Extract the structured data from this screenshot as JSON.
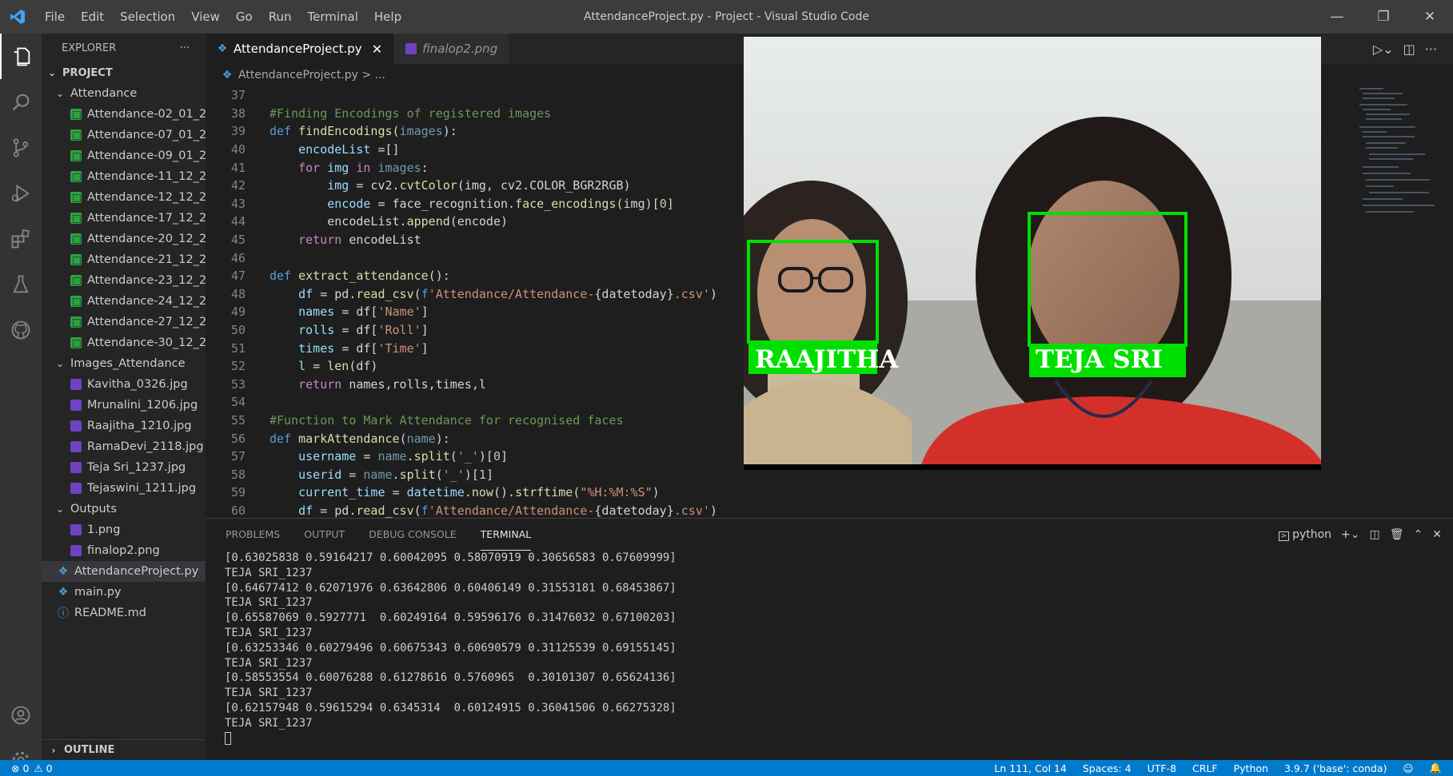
{
  "window": {
    "title": "AttendanceProject.py - Project - Visual Studio Code",
    "menu": [
      "File",
      "Edit",
      "Selection",
      "View",
      "Go",
      "Run",
      "Terminal",
      "Help"
    ],
    "controls": [
      "—",
      "❐",
      "✕"
    ]
  },
  "sidebar": {
    "header": "EXPLORER",
    "more": "···",
    "project_label": "PROJECT",
    "folders": {
      "attendance": "Attendance",
      "images": "Images_Attendance",
      "outputs": "Outputs"
    },
    "attendance_files": [
      "Attendance-02_01_2...",
      "Attendance-07_01_2...",
      "Attendance-09_01_2...",
      "Attendance-11_12_2...",
      "Attendance-12_12_2...",
      "Attendance-17_12_2...",
      "Attendance-20_12_2...",
      "Attendance-21_12_2...",
      "Attendance-23_12_2...",
      "Attendance-24_12_2...",
      "Attendance-27_12_2...",
      "Attendance-30_12_2..."
    ],
    "image_files": [
      "Kavitha_0326.jpg",
      "Mrunalini_1206.jpg",
      "Raajitha_1210.jpg",
      "RamaDevi_2118.jpg",
      "Teja Sri_1237.jpg",
      "Tejaswini_1211.jpg"
    ],
    "output_files": [
      "1.png",
      "finalop2.png"
    ],
    "root_files": {
      "attendance_project": "AttendanceProject.py",
      "main": "main.py",
      "readme": "README.md"
    },
    "outline": "OUTLINE"
  },
  "tabs": {
    "active": "AttendanceProject.py",
    "preview": "finalop2.png",
    "close": "✕"
  },
  "breadcrumb": "AttendanceProject.py  >  ...",
  "code": {
    "line_numbers": [
      "37",
      "38",
      "39",
      "40",
      "41",
      "42",
      "43",
      "44",
      "45",
      "46",
      "47",
      "48",
      "49",
      "50",
      "51",
      "52",
      "53",
      "54",
      "55",
      "56",
      "57",
      "58",
      "59",
      "60"
    ]
  },
  "camera": {
    "labels": [
      "RAAJITHA",
      "TEJA SRI"
    ],
    "box_color": "#00e000"
  },
  "panel": {
    "tabs": [
      "PROBLEMS",
      "OUTPUT",
      "DEBUG CONSOLE",
      "TERMINAL"
    ],
    "shell": "python",
    "terminal_lines": [
      "[0.63025838 0.59164217 0.60042095 0.58070919 0.30656583 0.67609999]",
      "TEJA SRI_1237",
      "[0.64677412 0.62071976 0.63642806 0.60406149 0.31553181 0.68453867]",
      "TEJA SRI_1237",
      "[0.65587069 0.5927771  0.60249164 0.59596176 0.31476032 0.67100203]",
      "TEJA SRI_1237",
      "[0.63253346 0.60279496 0.60675343 0.60690579 0.31125539 0.69155145]",
      "TEJA SRI_1237",
      "[0.58553554 0.60076288 0.61278616 0.5760965  0.30101307 0.65624136]",
      "TEJA SRI_1237",
      "[0.62157948 0.59615294 0.6345314  0.60124915 0.36041506 0.66275328]",
      "TEJA SRI_1237"
    ]
  },
  "status": {
    "errors": "⊗ 0",
    "warnings": "⚠ 0",
    "position": "Ln 111, Col 14",
    "spaces": "Spaces: 4",
    "encoding": "UTF-8",
    "eol": "CRLF",
    "language": "Python",
    "interpreter": "3.9.7 ('base': conda)"
  },
  "colors": {
    "accent": "#007acc",
    "csv_icon": "#2ea043",
    "image_icon": "#6f42c1"
  }
}
